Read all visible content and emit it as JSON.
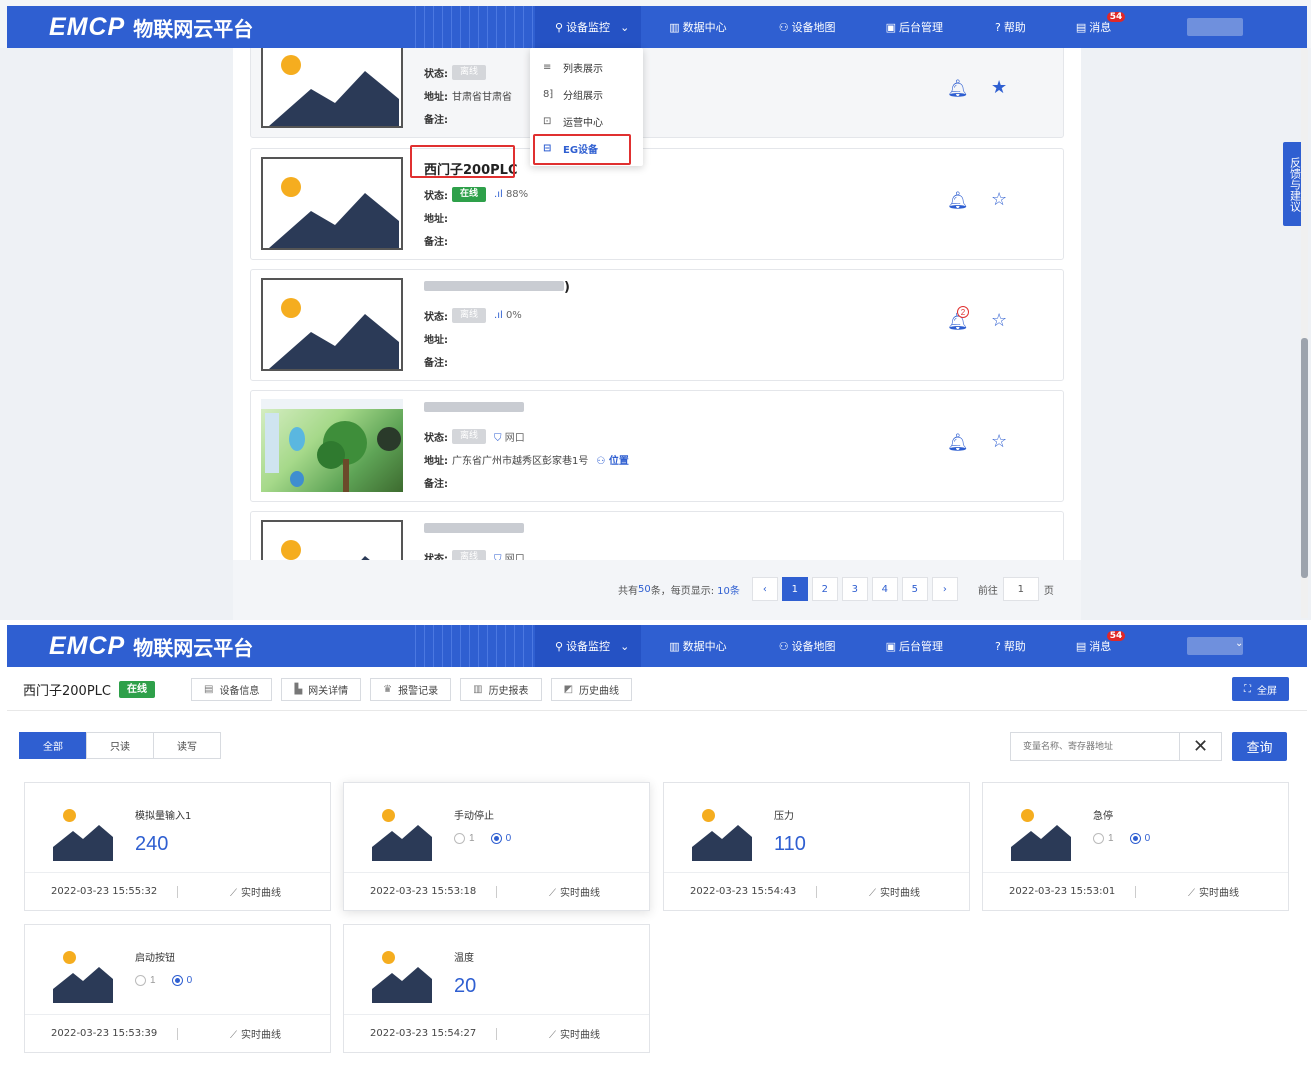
{
  "nav": {
    "brand": "EMCP",
    "subtitle": "物联网云平台",
    "items": [
      {
        "icon": "location-pin-icon",
        "label": "设备监控",
        "glyph": "⚲"
      },
      {
        "icon": "bar-chart-icon",
        "label": "数据中心",
        "glyph": "▥"
      },
      {
        "icon": "map-user-icon",
        "label": "设备地图",
        "glyph": "⚇"
      },
      {
        "icon": "monitor-icon",
        "label": "后台管理",
        "glyph": "▣"
      },
      {
        "icon": "help-circle-icon",
        "label": "帮助",
        "glyph": "?"
      },
      {
        "icon": "message-icon",
        "label": "消息",
        "glyph": "▤"
      }
    ],
    "message_badge": "54",
    "chevron": "⌄"
  },
  "dropdown": {
    "items": [
      {
        "icon": "list-icon",
        "glyph": "≡",
        "label": "列表展示"
      },
      {
        "icon": "group-icon",
        "glyph": "8⁆",
        "label": "分组展示"
      },
      {
        "icon": "ops-center-icon",
        "glyph": "⊡",
        "label": "运营中心"
      },
      {
        "icon": "eg-device-icon",
        "glyph": "⊟",
        "label": "EG设备"
      }
    ]
  },
  "labels": {
    "status": "状态:",
    "address": "地址:",
    "note": "备注:",
    "offline": "离线",
    "online": "在线",
    "position": "位置",
    "net_port": "网口"
  },
  "devices": [
    {
      "name": "",
      "status": "离线",
      "address": "甘肃省甘肃省",
      "note": "",
      "favorited": true
    },
    {
      "name": "西门子200PLC",
      "status": "在线",
      "signal": "88%",
      "address": "",
      "note": "",
      "favorited": false
    },
    {
      "name": ")",
      "status": "离线",
      "signal": "0%",
      "address": "",
      "note": "",
      "alarm_count": "2",
      "favorited": false
    },
    {
      "name": "",
      "status": "离线",
      "connection": "网口",
      "address": "广东省广州市越秀区彭家巷1号",
      "note": "",
      "favorited": false
    },
    {
      "name": "",
      "status": "离线",
      "connection": "网口",
      "address": "",
      "note": "",
      "favorited": false
    }
  ],
  "feedback": "反馈与建议",
  "pagination": {
    "total_prefix": "共有",
    "total": "50",
    "total_suffix": "条，每页显示:",
    "per_page": "10条",
    "pages": [
      "1",
      "2",
      "3",
      "4",
      "5"
    ],
    "current": "1",
    "prev": "‹",
    "next": "›",
    "goto_label": "前往",
    "goto_value": "1",
    "page_unit": "页"
  },
  "detail": {
    "device_name": "西门子200PLC",
    "status": "在线",
    "tabs": [
      {
        "icon": "device-info-icon",
        "glyph": "▤",
        "label": "设备信息"
      },
      {
        "icon": "gateway-icon",
        "glyph": "▙",
        "label": "网关详情"
      },
      {
        "icon": "alarm-icon",
        "glyph": "♛",
        "label": "报警记录"
      },
      {
        "icon": "report-icon",
        "glyph": "▥",
        "label": "历史报表"
      },
      {
        "icon": "curve-icon",
        "glyph": "◩",
        "label": "历史曲线"
      }
    ],
    "fullscreen": "全屏",
    "filters": [
      "全部",
      "只读",
      "读写"
    ],
    "active_filter": "全部",
    "search_placeholder": "变量名称、寄存器地址",
    "clear": "✕",
    "query": "查询",
    "realtime_label": "实时曲线",
    "variables": [
      {
        "name": "模拟量输入1",
        "type": "value",
        "value": "240",
        "time": "2022-03-23 15:55:32"
      },
      {
        "name": "手动停止",
        "type": "switch",
        "options": [
          "1",
          "0"
        ],
        "selected": "0",
        "time": "2022-03-23 15:53:18"
      },
      {
        "name": "压力",
        "type": "value",
        "value": "110",
        "time": "2022-03-23 15:54:43"
      },
      {
        "name": "急停",
        "type": "switch",
        "options": [
          "1",
          "0"
        ],
        "selected": "0",
        "time": "2022-03-23 15:53:01"
      },
      {
        "name": "启动按钮",
        "type": "switch",
        "options": [
          "1",
          "0"
        ],
        "selected": "0",
        "time": "2022-03-23 15:53:39"
      },
      {
        "name": "温度",
        "type": "value",
        "value": "20",
        "time": "2022-03-23 15:54:27"
      }
    ]
  },
  "colors": {
    "primary": "#2f5fd1",
    "online": "#2ea04a",
    "highlight": "#e03030",
    "sun": "#f5ad1f",
    "mountain": "#2b3a57"
  }
}
